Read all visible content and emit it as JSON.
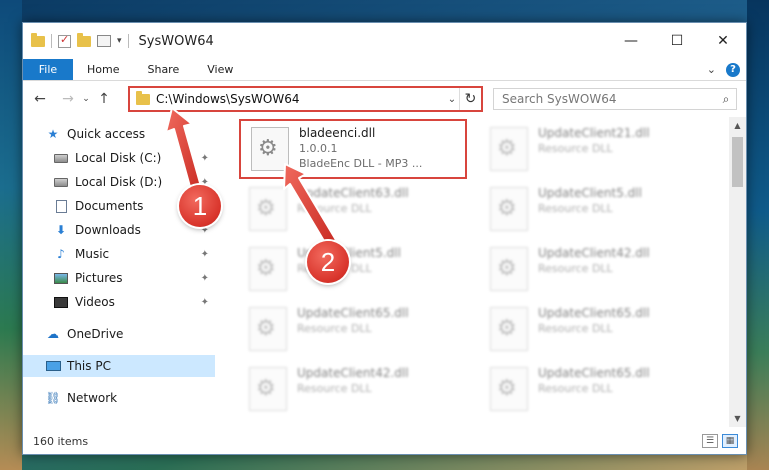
{
  "window": {
    "title": "SysWOW64",
    "controls": {
      "minimize": "—",
      "maximize": "☐",
      "close": "✕"
    }
  },
  "ribbon": {
    "tabs": [
      {
        "label": "File"
      },
      {
        "label": "Home"
      },
      {
        "label": "Share"
      },
      {
        "label": "View"
      }
    ],
    "help": "?",
    "expand": "⌄"
  },
  "nav": {
    "back": "←",
    "forward": "→",
    "recent": "⌄",
    "up": "↑"
  },
  "address": {
    "path": "C:\\Windows\\SysWOW64",
    "dropdown": "⌄",
    "refresh": "↻"
  },
  "search": {
    "placeholder": "Search SysWOW64",
    "icon": "⌕"
  },
  "sidebar": {
    "items": [
      {
        "label": "Quick access",
        "icon": "star-icon",
        "pinned": false
      },
      {
        "label": "Local Disk (C:)",
        "icon": "drive-icon",
        "pinned": true
      },
      {
        "label": "Local Disk (D:)",
        "icon": "drive-icon",
        "pinned": true
      },
      {
        "label": "Documents",
        "icon": "documents-icon",
        "pinned": true
      },
      {
        "label": "Downloads",
        "icon": "download-icon",
        "pinned": true
      },
      {
        "label": "Music",
        "icon": "music-icon",
        "pinned": true
      },
      {
        "label": "Pictures",
        "icon": "pictures-icon",
        "pinned": true
      },
      {
        "label": "Videos",
        "icon": "videos-icon",
        "pinned": true
      },
      {
        "label": "OneDrive",
        "icon": "cloud-icon",
        "pinned": false
      },
      {
        "label": "This PC",
        "icon": "computer-icon",
        "pinned": false,
        "selected": true
      },
      {
        "label": "Network",
        "icon": "network-icon",
        "pinned": false
      }
    ],
    "pin_glyph": "📌"
  },
  "files": [
    {
      "name": "bladeenci.dll",
      "line2": "1.0.0.1",
      "line3": "BladeEnc DLL - MP3 ...",
      "highlighted": true
    },
    {
      "name": "UpdateClient21.dll",
      "line2": "Resource DLL"
    },
    {
      "name": "UpdateClient63.dll",
      "line2": "Resource DLL"
    },
    {
      "name": "UpdateClient5.dll",
      "line2": "Resource DLL"
    },
    {
      "name": "UpdateClient5.dll",
      "line2": "Resource DLL"
    },
    {
      "name": "UpdateClient42.dll",
      "line2": "Resource DLL"
    },
    {
      "name": "UpdateClient65.dll",
      "line2": "Resource DLL"
    },
    {
      "name": "UpdateClient65.dll",
      "line2": "Resource DLL"
    },
    {
      "name": "UpdateClient42.dll",
      "line2": "Resource DLL"
    },
    {
      "name": "UpdateClient65.dll",
      "line2": "Resource DLL"
    }
  ],
  "status": {
    "count": "160 items"
  },
  "markers": [
    {
      "label": "1"
    },
    {
      "label": "2"
    }
  ],
  "colors": {
    "accent": "#1979ca",
    "annotation_red": "#d8453d",
    "selection": "#cce8ff"
  }
}
